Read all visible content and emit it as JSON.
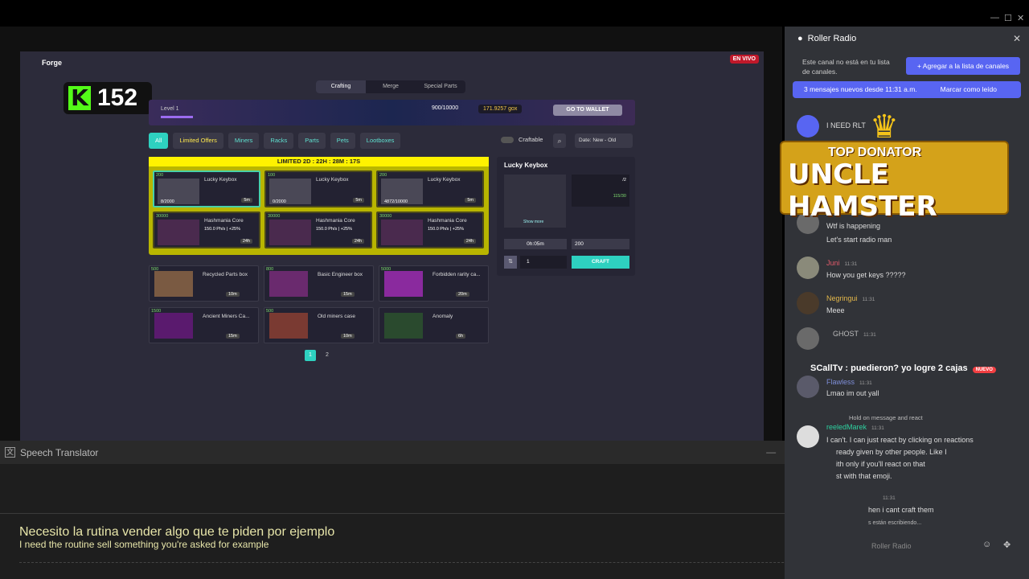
{
  "game": {
    "title": "Forge",
    "live_badge": "EN VIVO",
    "kick_viewers": "152",
    "tabs": [
      "Crafting",
      "Merge",
      "Special Parts"
    ],
    "level": "Level 1",
    "power": "900/10000",
    "coins": "171.9257 gox",
    "wallet_btn": "GO TO WALLET",
    "categories": [
      "All",
      "Limited Offers",
      "Miners",
      "Racks",
      "Parts",
      "Pets",
      "Lootboxes"
    ],
    "craftable": "Craftable",
    "sort": "Date: New - Old",
    "limited_title": "LIMITED 2D : 22H : 28M : 17S",
    "limited_cards": [
      {
        "badge": "200",
        "name": "Lucky Keybox",
        "sub": "",
        "count": "8/2000",
        "time": "5m"
      },
      {
        "badge": "100",
        "name": "Lucky Keybox",
        "sub": "",
        "count": "0/2000",
        "time": "5m"
      },
      {
        "badge": "200",
        "name": "Lucky Keybox",
        "sub": "",
        "count": "4872/10000",
        "time": "5m"
      },
      {
        "badge": "30000",
        "name": "Hashmania Core",
        "sub": "150.0 Ph/s | +25%",
        "count": "",
        "time": "24h"
      },
      {
        "badge": "30000",
        "name": "Hashmania Core",
        "sub": "150.0 Ph/s | +25%",
        "count": "",
        "time": "24h"
      },
      {
        "badge": "30000",
        "name": "Hashmania Core",
        "sub": "150.0 Ph/s | +25%",
        "count": "",
        "time": "24h"
      }
    ],
    "cards": [
      {
        "badge": "500",
        "name": "Recycled Parts box",
        "time": "10m"
      },
      {
        "badge": "800",
        "name": "Basic Engineer box",
        "time": "15m"
      },
      {
        "badge": "5000",
        "name": "Forbidden rarity ca...",
        "time": "20m"
      },
      {
        "badge": "1500",
        "name": "Ancient Miners Ca...",
        "time": "15m"
      },
      {
        "badge": "500",
        "name": "Old miners case",
        "time": "10m"
      },
      {
        "badge": "",
        "name": "Anomaly",
        "time": "6h"
      }
    ],
    "pages": [
      "1",
      "2"
    ],
    "detail": {
      "title": "Lucky Keybox",
      "show_more": "Show more",
      "req1": "/2",
      "req2": "115/30",
      "time": "0h:05m",
      "cost": "200",
      "qty": "1",
      "craft_btn": "CRAFT"
    }
  },
  "translator": {
    "title": "Speech Translator",
    "spanish": "Necesito la rutina vender algo que te piden por ejemplo",
    "english": "I need the routine sell something you're asked for example"
  },
  "discord": {
    "channel": "Roller Radio",
    "notice": "Este canal no está en tu lista de canales.",
    "add_btn": "+ Agregar a la lista de canales",
    "new_msgs": "3 mensajes nuevos desde 11:31 a.m.",
    "mark_read": "Marcar como leído",
    "donator_top": "TOP DONATOR",
    "donator_name": "UNCLE HAMSTER",
    "messages": [
      {
        "name": "",
        "time": "11:31",
        "lines": [
          "I NEED RLT"
        ]
      },
      {
        "name": "GHOST",
        "time": "11:31",
        "lines": [
          "Wtf is happening",
          "Let's start radio man"
        ]
      },
      {
        "name": "Juni",
        "time": "11:31",
        "lines": [
          "How you get keys ?????"
        ]
      },
      {
        "name": "Negringui",
        "time": "11:31",
        "lines": [
          "Meee"
        ]
      },
      {
        "name": "GHOST",
        "time": "11:31",
        "lines": [
          "SCallTv : puedieron? yo logre 2 cajas"
        ]
      },
      {
        "name": "Flawless",
        "time": "11:31",
        "lines": [
          "Lmao im out yall"
        ]
      },
      {
        "name": "reeledMarek",
        "time": "11:31",
        "lines": [
          "I can't. I can just react by clicking on reactions",
          "ready given by other people. Like I",
          "ith only if you'll react on that",
          "st with that emoji."
        ]
      },
      {
        "name": "",
        "time": "11:31",
        "lines": [
          "hen i cant craft them"
        ]
      }
    ],
    "reply_to": "Hold on message and react",
    "nuevo": "NUEVO",
    "typing": "s están escribiendo...",
    "input_placeholder": "Roller Radio"
  }
}
